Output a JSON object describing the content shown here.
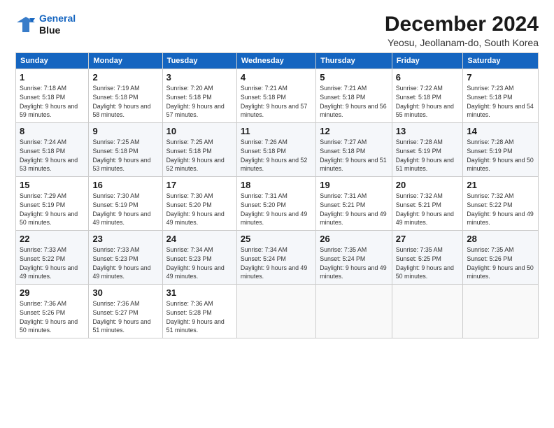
{
  "logo": {
    "line1": "General",
    "line2": "Blue"
  },
  "title": "December 2024",
  "subtitle": "Yeosu, Jeollanam-do, South Korea",
  "days_of_week": [
    "Sunday",
    "Monday",
    "Tuesday",
    "Wednesday",
    "Thursday",
    "Friday",
    "Saturday"
  ],
  "weeks": [
    [
      {
        "day": "1",
        "sunrise": "7:18 AM",
        "sunset": "5:18 PM",
        "daylight": "9 hours and 59 minutes."
      },
      {
        "day": "2",
        "sunrise": "7:19 AM",
        "sunset": "5:18 PM",
        "daylight": "9 hours and 58 minutes."
      },
      {
        "day": "3",
        "sunrise": "7:20 AM",
        "sunset": "5:18 PM",
        "daylight": "9 hours and 57 minutes."
      },
      {
        "day": "4",
        "sunrise": "7:21 AM",
        "sunset": "5:18 PM",
        "daylight": "9 hours and 57 minutes."
      },
      {
        "day": "5",
        "sunrise": "7:21 AM",
        "sunset": "5:18 PM",
        "daylight": "9 hours and 56 minutes."
      },
      {
        "day": "6",
        "sunrise": "7:22 AM",
        "sunset": "5:18 PM",
        "daylight": "9 hours and 55 minutes."
      },
      {
        "day": "7",
        "sunrise": "7:23 AM",
        "sunset": "5:18 PM",
        "daylight": "9 hours and 54 minutes."
      }
    ],
    [
      {
        "day": "8",
        "sunrise": "7:24 AM",
        "sunset": "5:18 PM",
        "daylight": "9 hours and 53 minutes."
      },
      {
        "day": "9",
        "sunrise": "7:25 AM",
        "sunset": "5:18 PM",
        "daylight": "9 hours and 53 minutes."
      },
      {
        "day": "10",
        "sunrise": "7:25 AM",
        "sunset": "5:18 PM",
        "daylight": "9 hours and 52 minutes."
      },
      {
        "day": "11",
        "sunrise": "7:26 AM",
        "sunset": "5:18 PM",
        "daylight": "9 hours and 52 minutes."
      },
      {
        "day": "12",
        "sunrise": "7:27 AM",
        "sunset": "5:18 PM",
        "daylight": "9 hours and 51 minutes."
      },
      {
        "day": "13",
        "sunrise": "7:28 AM",
        "sunset": "5:19 PM",
        "daylight": "9 hours and 51 minutes."
      },
      {
        "day": "14",
        "sunrise": "7:28 AM",
        "sunset": "5:19 PM",
        "daylight": "9 hours and 50 minutes."
      }
    ],
    [
      {
        "day": "15",
        "sunrise": "7:29 AM",
        "sunset": "5:19 PM",
        "daylight": "9 hours and 50 minutes."
      },
      {
        "day": "16",
        "sunrise": "7:30 AM",
        "sunset": "5:19 PM",
        "daylight": "9 hours and 49 minutes."
      },
      {
        "day": "17",
        "sunrise": "7:30 AM",
        "sunset": "5:20 PM",
        "daylight": "9 hours and 49 minutes."
      },
      {
        "day": "18",
        "sunrise": "7:31 AM",
        "sunset": "5:20 PM",
        "daylight": "9 hours and 49 minutes."
      },
      {
        "day": "19",
        "sunrise": "7:31 AM",
        "sunset": "5:21 PM",
        "daylight": "9 hours and 49 minutes."
      },
      {
        "day": "20",
        "sunrise": "7:32 AM",
        "sunset": "5:21 PM",
        "daylight": "9 hours and 49 minutes."
      },
      {
        "day": "21",
        "sunrise": "7:32 AM",
        "sunset": "5:22 PM",
        "daylight": "9 hours and 49 minutes."
      }
    ],
    [
      {
        "day": "22",
        "sunrise": "7:33 AM",
        "sunset": "5:22 PM",
        "daylight": "9 hours and 49 minutes."
      },
      {
        "day": "23",
        "sunrise": "7:33 AM",
        "sunset": "5:23 PM",
        "daylight": "9 hours and 49 minutes."
      },
      {
        "day": "24",
        "sunrise": "7:34 AM",
        "sunset": "5:23 PM",
        "daylight": "9 hours and 49 minutes."
      },
      {
        "day": "25",
        "sunrise": "7:34 AM",
        "sunset": "5:24 PM",
        "daylight": "9 hours and 49 minutes."
      },
      {
        "day": "26",
        "sunrise": "7:35 AM",
        "sunset": "5:24 PM",
        "daylight": "9 hours and 49 minutes."
      },
      {
        "day": "27",
        "sunrise": "7:35 AM",
        "sunset": "5:25 PM",
        "daylight": "9 hours and 50 minutes."
      },
      {
        "day": "28",
        "sunrise": "7:35 AM",
        "sunset": "5:26 PM",
        "daylight": "9 hours and 50 minutes."
      }
    ],
    [
      {
        "day": "29",
        "sunrise": "7:36 AM",
        "sunset": "5:26 PM",
        "daylight": "9 hours and 50 minutes."
      },
      {
        "day": "30",
        "sunrise": "7:36 AM",
        "sunset": "5:27 PM",
        "daylight": "9 hours and 51 minutes."
      },
      {
        "day": "31",
        "sunrise": "7:36 AM",
        "sunset": "5:28 PM",
        "daylight": "9 hours and 51 minutes."
      },
      null,
      null,
      null,
      null
    ]
  ]
}
